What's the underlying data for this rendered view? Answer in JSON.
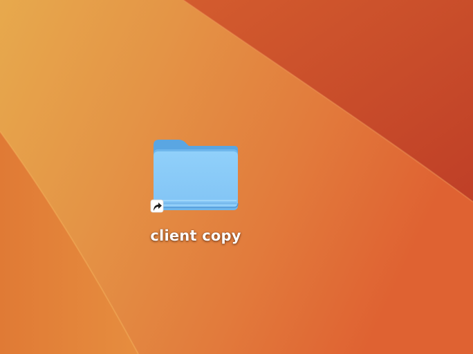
{
  "desktop": {
    "wallpaper": {
      "colors": {
        "base": "#e36f33",
        "dark_red": "#c2442a",
        "highlight_yellow": "#e6a74c",
        "mid_orange": "#e8773a",
        "deep_orange": "#d9542b"
      }
    },
    "items": [
      {
        "label": "client copy",
        "icon": "folder-icon",
        "badge": "alias-arrow-icon",
        "colors": {
          "front": "#8ccdf8",
          "back": "#5aa6e2",
          "edge": "#4a92d2"
        }
      }
    ]
  }
}
